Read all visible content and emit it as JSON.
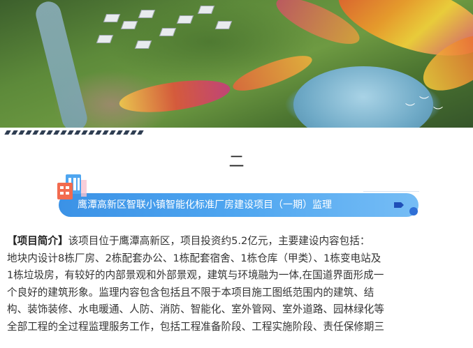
{
  "section": {
    "number": "二"
  },
  "banner": {
    "title": "鹰潭高新区智联小镇智能化标准厂房建设项目（一期）监理"
  },
  "article": {
    "intro_label": "【项目简介】",
    "lines": [
      "该项目位于鹰潭高新区，项目投资约5.2亿元，主要建设内容包括：",
      "地块内设计8栋厂房、2栋配套办公、1栋配套宿舍、1栋仓库（甲类）、1栋变电站及",
      "1栋垃圾房，有较好的内部景观和外部景观，建筑与环境融为一体,在国道界面形成一",
      "个良好的建筑形象。监理内容包含包括且不限于本项目施工图纸范围内的建筑、结",
      "构、装饰装修、水电暖通、人防、消防、智能化、室外管网、室外道路、园林绿化等",
      "全部工程的全过程监理服务工作，包括工程准备阶段、工程实施阶段、责任保修期三"
    ]
  },
  "colors": {
    "banner": "#3b92e6",
    "banner_dot": "#2f6fd6",
    "text": "#333333"
  }
}
